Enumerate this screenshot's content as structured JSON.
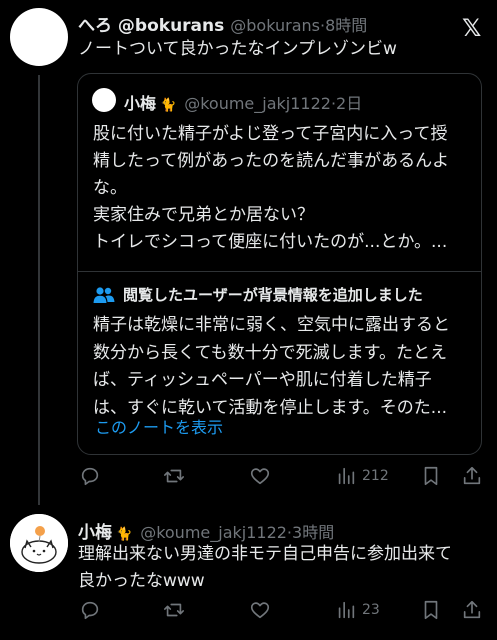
{
  "tweet": {
    "display_name": "へろ @bokurans",
    "handle": "@bokurans",
    "time": "8時間",
    "text": "ノートついて良かったなインプレゾンビw"
  },
  "quote": {
    "display_name": "小梅",
    "handle": "@koume_jakj1122",
    "time": "2日",
    "text_lines": [
      "股に付いた精子がよじ登って子宮内に入って授",
      "精したって例があったのを読んだ事があるんよ",
      "な。",
      "実家住みで兄弟とか居ない？",
      "トイレでシコって便座に付いたのが...とか。..."
    ]
  },
  "note": {
    "header": "閲覧したユーザーが背景情報を追加しました",
    "lines": [
      "精子は乾燥に非常に弱く、空気中に露出すると",
      "数分から長くても数十分で死滅します。たとえ",
      "ば、ティッシュペーパーや肌に付着した精子",
      "は、すぐに乾いて活動を停止します。そのた..."
    ],
    "show_link": "このノートを表示"
  },
  "tweet_actions": {
    "views": "212"
  },
  "reply": {
    "display_name": "小梅",
    "handle": "@koume_jakj1122",
    "time": "3時間",
    "text_lines": [
      "理解出来ない男達の非モテ自己申告に参加出来て",
      "良かったなwww"
    ]
  },
  "reply_actions": {
    "views": "23"
  },
  "colors": {
    "background": "#000000",
    "text": "#e7e9ea",
    "muted": "#71767b",
    "link": "#1d9bf0",
    "border": "#2f3336"
  },
  "icons": [
    "x-logo-icon",
    "reply-icon",
    "retweet-icon",
    "like-icon",
    "views-icon",
    "bookmark-icon",
    "share-icon",
    "people-icon",
    "badge-icon"
  ]
}
